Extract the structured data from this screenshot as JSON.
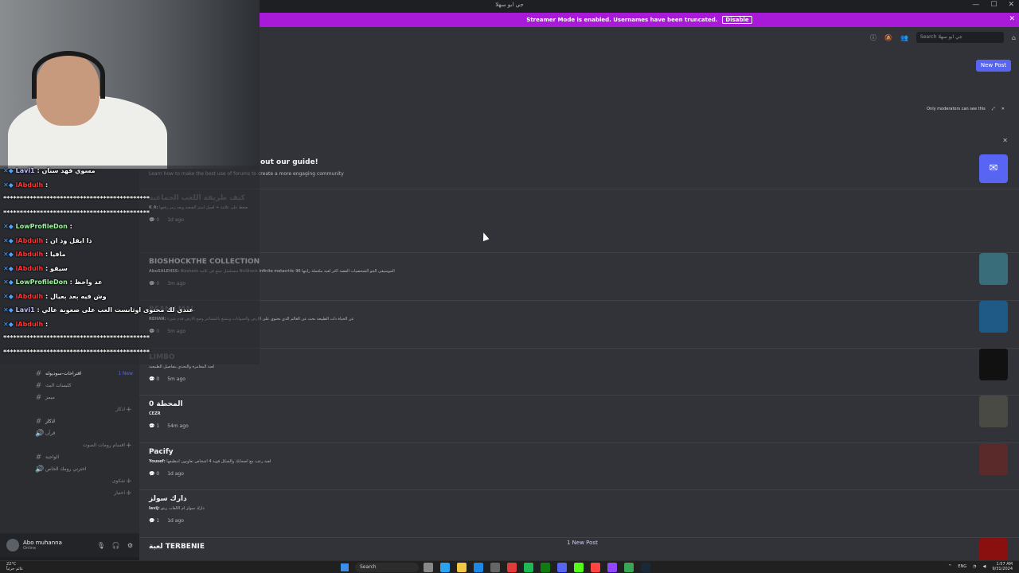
{
  "window": {
    "title": "جي ابو سهلا",
    "minimize": "—",
    "maximize": "☐",
    "close": "✕"
  },
  "banner": {
    "text": "Streamer Mode is enabled. Usernames have been truncated.",
    "disable_label": "Disable",
    "close": "✕"
  },
  "header": {
    "search_placeholder": "Search جي ابو سهلا",
    "new_post_label": "New Post",
    "mod_note": "Only moderators can see this"
  },
  "guide": {
    "title": "out our guide!",
    "subtitle": "Learn how to make the best use of forums to create a more engaging community",
    "close": "✕"
  },
  "posts": [
    {
      "title": "كيف طريقة اللعب الجماعية",
      "author": "K A:",
      "excerpt": "ضغط على علامة + لعمل اسم الشعبة وبعد رمز رفعها",
      "replies": "0",
      "time": "1d ago",
      "dim": true,
      "thumb": ""
    },
    {
      "title": "BIOSHOCKTHE COLLECTION",
      "author": "AbuSALEHSS:",
      "excerpt": "Bioshock متسلسل جمع في ثلاثية BioShock Infinite metacritic 96 الموسيقى الجو الشخصيات القصة أكثر لعبة مكتملة رأيتها",
      "replies": "0",
      "time": "3m ago",
      "dim": false,
      "thumb": "#3a6d7a"
    },
    {
      "title": "BEANILMAL",
      "author": "REHAN:",
      "excerpt": "عن الحياة ذات الطبيعة بحث عن العالم الذي يحتوي على الأرض والحيوانات ويتمتع بالمشاعر وضع الأرض قدم شيء",
      "replies": "0",
      "time": "5m ago",
      "dim": true,
      "thumb": "#1f5a86"
    },
    {
      "title": "LIMBO",
      "author": "",
      "excerpt": "لعبة المغامرة والتحدي بتفاصيل الطبيعية",
      "replies": "0",
      "time": "5m ago",
      "dim": true,
      "thumb": "#111111"
    },
    {
      "title": "المحطة 0",
      "author": "CEZR",
      "excerpt": "",
      "replies": "1",
      "time": "54m ago",
      "dim": false,
      "thumb": "#4a4a44"
    },
    {
      "title": "Pacify",
      "author": "Yousef:",
      "excerpt": "لعبة رعب مع اصحابك والشكل قوية 4 اشخاص تعاونون لتنظيفها",
      "replies": "0",
      "time": "1d ago",
      "dim": false,
      "thumb": "#5a2a2a"
    },
    {
      "title": "دارك سولز",
      "author": "lavij:",
      "excerpt": "دارك سولز ام الالعاب ريتو",
      "replies": "1",
      "time": "1d ago",
      "dim": false,
      "thumb": ""
    },
    {
      "title": "لعبة TERBENIE",
      "author": "",
      "excerpt": "",
      "replies": "",
      "time": "",
      "dim": false,
      "thumb": "#8a1010"
    }
  ],
  "new_posts_pill": "1 New Post",
  "channels": [
    {
      "type": "channel",
      "label": "اقتراحات-سوديوله",
      "badge": "1 New",
      "active": true
    },
    {
      "type": "channel",
      "label": "كلبسات البث",
      "badge": "",
      "active": false
    },
    {
      "type": "channel",
      "label": "ميمز",
      "badge": "",
      "active": false
    },
    {
      "type": "category",
      "label": "اذكار",
      "badge": "",
      "active": false
    },
    {
      "type": "channel",
      "label": "اذكار",
      "badge": "",
      "active": true
    },
    {
      "type": "voice",
      "label": "قرآن",
      "badge": "",
      "active": false
    },
    {
      "type": "category",
      "label": "اقسام رومات الصوت",
      "badge": "",
      "active": false
    },
    {
      "type": "channel",
      "label": "الواجبة",
      "badge": "",
      "active": false
    },
    {
      "type": "voice",
      "label": "اخترني رومك الخاص",
      "badge": "",
      "active": false
    },
    {
      "type": "category",
      "label": "شكوى",
      "badge": "",
      "active": false
    },
    {
      "type": "category",
      "label": "اختيار",
      "badge": "",
      "active": false
    }
  ],
  "user": {
    "name": "Abo muhanna",
    "status": "Online"
  },
  "chat": [
    {
      "user": "Lavi1",
      "text": ": مسوي فهد سنان",
      "color": "u1"
    },
    {
      "user": "iAbdulh",
      "text": ":",
      "color": "u2"
    },
    {
      "user": "",
      "text": "********************************************",
      "color": ""
    },
    {
      "user": "",
      "text": "********************************************",
      "color": ""
    },
    {
      "user": "LowProfileDon",
      "text": ":",
      "color": "u3"
    },
    {
      "user": "iAbdulh",
      "text": ": ذا ايقل وذ ان",
      "color": "u2"
    },
    {
      "user": "iAbdulh",
      "text": ": مافيا",
      "color": "u2"
    },
    {
      "user": "iAbdulh",
      "text": ": سيقو",
      "color": "u2"
    },
    {
      "user": "LowProfileDon",
      "text": ": عد واخظ",
      "color": "u3"
    },
    {
      "user": "iAbdulh",
      "text": ": وش فيه بعد بعيال",
      "color": "u2"
    },
    {
      "user": "Lavi1",
      "text": ": عندي لك محتوى اوثانست العب على صعوبة عالي",
      "color": "u1"
    },
    {
      "user": "iAbdulh",
      "text": ":",
      "color": "u2"
    },
    {
      "user": "",
      "text": "********************************************",
      "color": ""
    },
    {
      "user": "",
      "text": "********************************************",
      "color": ""
    }
  ],
  "taskbar": {
    "weather_temp": "22°C",
    "weather_desc": "غائم جزئياً",
    "search_label": "Search",
    "lang": "ENG",
    "time": "1:57 AM",
    "date": "9/31/2024"
  }
}
